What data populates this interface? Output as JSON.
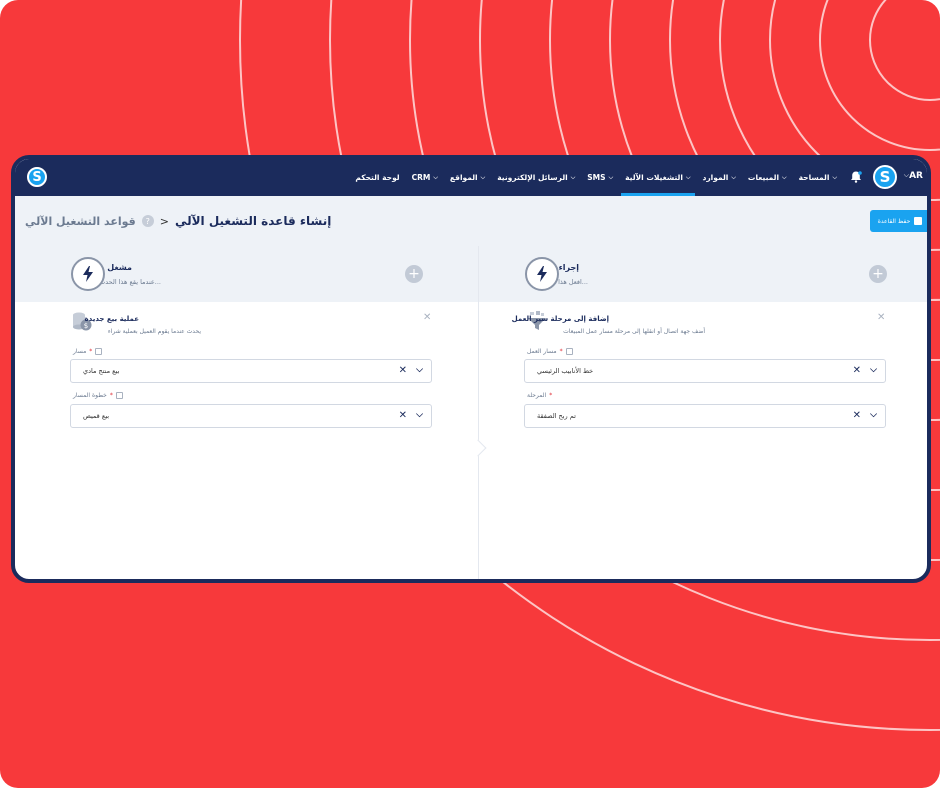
{
  "nav": {
    "lang": "AR",
    "items": [
      {
        "label": "المساحة",
        "caret": true
      },
      {
        "label": "المبيعات",
        "caret": true
      },
      {
        "label": "الموارد",
        "caret": true
      },
      {
        "label": "التشغيلات الآلية",
        "caret": true,
        "active": true
      },
      {
        "label": "SMS",
        "caret": true
      },
      {
        "label": "الرسائل الإلكترونية",
        "caret": true
      },
      {
        "label": "المواقع",
        "caret": true
      },
      {
        "label": "CRM",
        "caret": true
      },
      {
        "label": "لوحة التحكم",
        "caret": false
      }
    ],
    "logo_letter": "S"
  },
  "header": {
    "current": "إنشاء قاعدة التشغيل الآلي",
    "separator": "<",
    "parent": "قواعد التشغيل الآلي",
    "help": "?",
    "save_label": "حفظ القاعدة"
  },
  "trigger": {
    "title": "مشغل",
    "subtitle": "عندما يقع هذا الحدث...",
    "card_title": "عملية بيع جديدة",
    "card_sub": "يحدث عندما يقوم العميل بعملية شراء",
    "fields": [
      {
        "label": "مسار",
        "required": "*",
        "value": "بيع منتج مادي"
      },
      {
        "label": "خطوة المسار",
        "required": "*",
        "value": "بيع قميص"
      }
    ]
  },
  "action": {
    "title": "إجراء",
    "subtitle": "افعل هذا...",
    "card_title": "إضافة إلى مرحلة سير العمل",
    "card_sub": "أضف جهة اتصال أو انقلها إلى مرحلة مسار عمل المبيعات",
    "fields": [
      {
        "label": "مسار العمل",
        "required": "*",
        "value": "خط الأنابيب الرئيسي"
      },
      {
        "label": "المرحلة",
        "required": "*",
        "value": "تم ربح الصفقة"
      }
    ]
  },
  "colors": {
    "background": "#f7393b",
    "navbar": "#1b2b5c",
    "accent": "#1aa3f0"
  }
}
